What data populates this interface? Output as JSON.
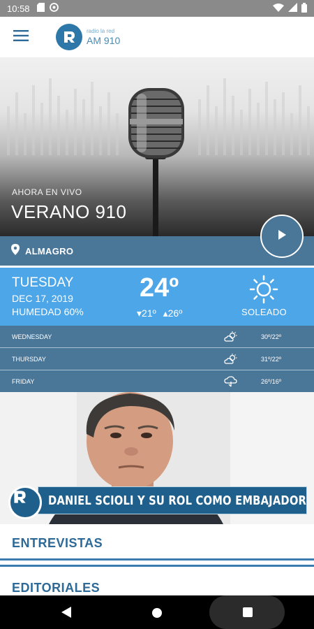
{
  "status_bar": {
    "time": "10:58"
  },
  "app_bar": {
    "logo_small": "radio la red",
    "logo_big": "AM 910"
  },
  "hero": {
    "live_label": "AHORA EN VIVO",
    "show_title": "VERANO 910"
  },
  "location": {
    "name": "ALMAGRO"
  },
  "weather": {
    "today": {
      "day": "TUESDAY",
      "date": "DEC 17, 2019",
      "humidity": "HUMEDAD 60%",
      "temp": "24º",
      "min": "21º",
      "max": "26º",
      "condition": "SOLEADO",
      "icon": "sun-icon"
    },
    "forecast": [
      {
        "day": "WEDNESDAY",
        "range": "30º/22º",
        "icon": "cloud-sun-icon"
      },
      {
        "day": "THURSDAY",
        "range": "31º/22º",
        "icon": "cloud-sun-icon"
      },
      {
        "day": "FRIDAY",
        "range": "26º/16º",
        "icon": "rain-cloud-icon"
      }
    ]
  },
  "news": {
    "headline": "DANIEL SCIOLI Y SU ROL COMO EMBAJADOR"
  },
  "sections": [
    {
      "label": "ENTREVISTAS"
    },
    {
      "label": "EDITORIALES"
    }
  ],
  "colors": {
    "primary": "#4a7698",
    "weather_blue": "#4da6e8",
    "accent_text": "#2d6a98",
    "status_bar": "#8a8a8a"
  }
}
